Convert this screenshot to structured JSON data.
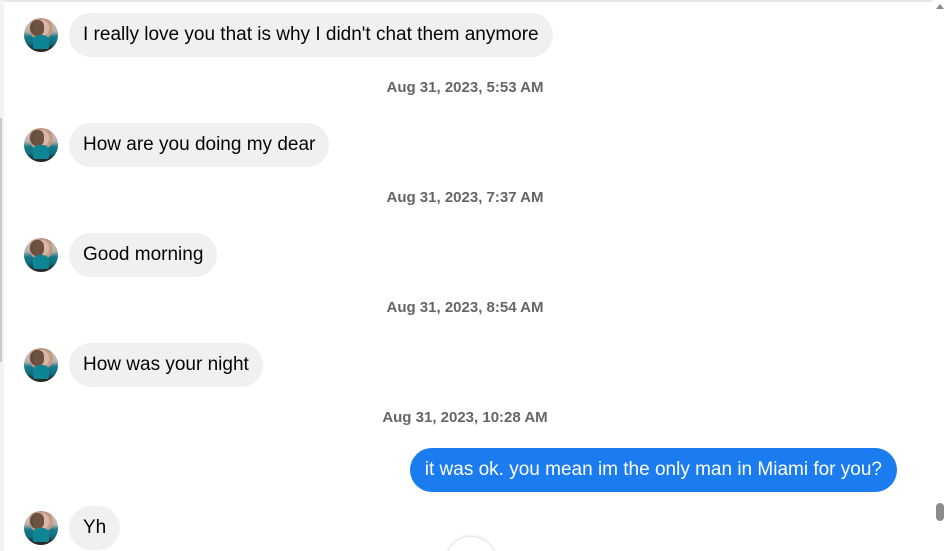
{
  "contact": {
    "avatar_icon": "profile-photo-avatar"
  },
  "messages": [
    {
      "direction": "incoming",
      "text": "I really love you that is why I didn't chat them anymore"
    },
    {
      "type": "timestamp",
      "text": "Aug 31, 2023, 5:53 AM"
    },
    {
      "direction": "incoming",
      "text": "How are you doing my dear"
    },
    {
      "type": "timestamp",
      "text": "Aug 31, 2023, 7:37 AM"
    },
    {
      "direction": "incoming",
      "text": "Good morning"
    },
    {
      "type": "timestamp",
      "text": "Aug 31, 2023, 8:54 AM"
    },
    {
      "direction": "incoming",
      "text": "How was your night"
    },
    {
      "type": "timestamp",
      "text": "Aug 31, 2023, 10:28 AM"
    },
    {
      "direction": "outgoing",
      "text": "it was ok. you mean im the only man in Miami for you?"
    },
    {
      "direction": "incoming",
      "text": "Yh"
    }
  ],
  "colors": {
    "incoming_bubble": "#f0f0f0",
    "outgoing_bubble": "#1b7cf0",
    "timestamp_text": "#656565"
  },
  "icons": {
    "scroll_up": "scroll-up-arrow-icon",
    "scroll_down_fab": "scroll-to-bottom-icon"
  }
}
